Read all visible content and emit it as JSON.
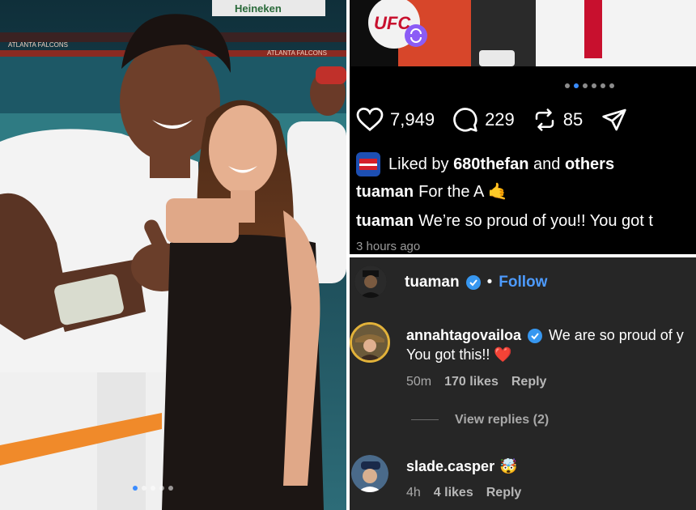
{
  "photo": {
    "banner_text": "Heineken",
    "stadium_text_left": "ATLANTA FALCONS",
    "stadium_text_right": "ATLANTA FALCONS",
    "carousel_count": 5,
    "carousel_active": 0
  },
  "post": {
    "badge_text": "UFC",
    "carousel_count": 6,
    "carousel_active": 1,
    "likes": "7,949",
    "comments": "229",
    "reposts": "85",
    "liked_by_prefix": "Liked by",
    "liked_by_user": "680thefan",
    "liked_by_and": "and",
    "liked_by_others": "others",
    "captions": [
      {
        "user": "tuaman",
        "text": "For the A 🤙"
      },
      {
        "user": "tuaman",
        "text": "We’re so proud of you!! You got t"
      }
    ],
    "timestamp": "3 hours ago"
  },
  "comments": {
    "header_user": "tuaman",
    "follow_separator": "•",
    "follow_label": "Follow",
    "items": [
      {
        "user": "annahtagovailoa",
        "text_line1": "We are so proud of y",
        "text_line2": "You got this!! ❤️",
        "time": "50m",
        "likes": "170 likes",
        "reply": "Reply",
        "view_replies": "View replies (2)"
      },
      {
        "user": "slade.casper",
        "emoji": "🤯",
        "time": "4h",
        "likes": "4 likes",
        "reply": "Reply"
      }
    ]
  },
  "colors": {
    "verified": "#3797f0",
    "follow": "#4d9bff",
    "dark_bg": "#000000",
    "comments_bg": "#262626"
  }
}
